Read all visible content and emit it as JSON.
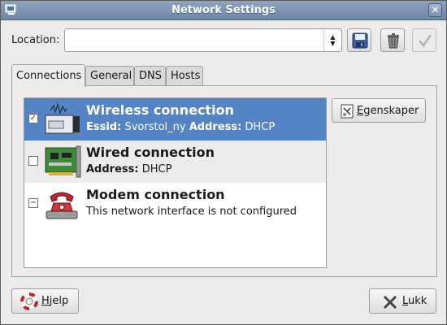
{
  "window": {
    "title": "Network Settings"
  },
  "location": {
    "label": "Location:",
    "value": ""
  },
  "toolbar": {
    "save": "save-icon",
    "delete": "trash-icon",
    "apply": "checkmark-icon"
  },
  "tabs": [
    {
      "label": "Connections",
      "active": true
    },
    {
      "label": "General"
    },
    {
      "label": "DNS"
    },
    {
      "label": "Hosts"
    }
  ],
  "connections": [
    {
      "name": "Wireless connection",
      "detail_k1": "Essid:",
      "detail_v1": "Svorstol_ny",
      "detail_k2": "Address:",
      "detail_v2": "DHCP",
      "checked": true,
      "selected": true,
      "icon": "wireless-card-icon"
    },
    {
      "name": "Wired connection",
      "detail_k1": "Address:",
      "detail_v1": "DHCP",
      "checked": false,
      "icon": "ethernet-card-icon"
    },
    {
      "name": "Modem connection",
      "detail": "This network interface is not configured",
      "checked": "mixed",
      "icon": "telephone-modem-icon"
    }
  ],
  "buttons": {
    "properties": {
      "accel": "E",
      "rest": "genskaper"
    },
    "help": {
      "accel": "H",
      "rest": "jelp"
    },
    "close": {
      "accel": "L",
      "rest": "ukk"
    }
  },
  "colors": {
    "selection": "#5484c6",
    "titlebar": "#7d93b0"
  }
}
